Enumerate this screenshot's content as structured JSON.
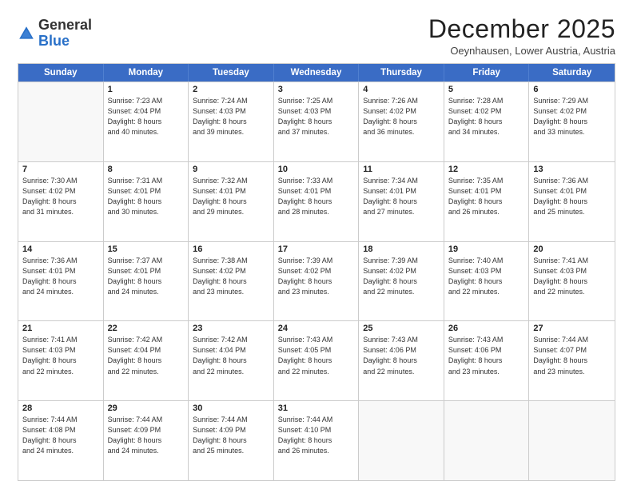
{
  "logo": {
    "general": "General",
    "blue": "Blue"
  },
  "title": "December 2025",
  "subtitle": "Oeynhausen, Lower Austria, Austria",
  "days": [
    "Sunday",
    "Monday",
    "Tuesday",
    "Wednesday",
    "Thursday",
    "Friday",
    "Saturday"
  ],
  "rows": [
    [
      {
        "day": "",
        "lines": []
      },
      {
        "day": "1",
        "lines": [
          "Sunrise: 7:23 AM",
          "Sunset: 4:04 PM",
          "Daylight: 8 hours",
          "and 40 minutes."
        ]
      },
      {
        "day": "2",
        "lines": [
          "Sunrise: 7:24 AM",
          "Sunset: 4:03 PM",
          "Daylight: 8 hours",
          "and 39 minutes."
        ]
      },
      {
        "day": "3",
        "lines": [
          "Sunrise: 7:25 AM",
          "Sunset: 4:03 PM",
          "Daylight: 8 hours",
          "and 37 minutes."
        ]
      },
      {
        "day": "4",
        "lines": [
          "Sunrise: 7:26 AM",
          "Sunset: 4:02 PM",
          "Daylight: 8 hours",
          "and 36 minutes."
        ]
      },
      {
        "day": "5",
        "lines": [
          "Sunrise: 7:28 AM",
          "Sunset: 4:02 PM",
          "Daylight: 8 hours",
          "and 34 minutes."
        ]
      },
      {
        "day": "6",
        "lines": [
          "Sunrise: 7:29 AM",
          "Sunset: 4:02 PM",
          "Daylight: 8 hours",
          "and 33 minutes."
        ]
      }
    ],
    [
      {
        "day": "7",
        "lines": [
          "Sunrise: 7:30 AM",
          "Sunset: 4:02 PM",
          "Daylight: 8 hours",
          "and 31 minutes."
        ]
      },
      {
        "day": "8",
        "lines": [
          "Sunrise: 7:31 AM",
          "Sunset: 4:01 PM",
          "Daylight: 8 hours",
          "and 30 minutes."
        ]
      },
      {
        "day": "9",
        "lines": [
          "Sunrise: 7:32 AM",
          "Sunset: 4:01 PM",
          "Daylight: 8 hours",
          "and 29 minutes."
        ]
      },
      {
        "day": "10",
        "lines": [
          "Sunrise: 7:33 AM",
          "Sunset: 4:01 PM",
          "Daylight: 8 hours",
          "and 28 minutes."
        ]
      },
      {
        "day": "11",
        "lines": [
          "Sunrise: 7:34 AM",
          "Sunset: 4:01 PM",
          "Daylight: 8 hours",
          "and 27 minutes."
        ]
      },
      {
        "day": "12",
        "lines": [
          "Sunrise: 7:35 AM",
          "Sunset: 4:01 PM",
          "Daylight: 8 hours",
          "and 26 minutes."
        ]
      },
      {
        "day": "13",
        "lines": [
          "Sunrise: 7:36 AM",
          "Sunset: 4:01 PM",
          "Daylight: 8 hours",
          "and 25 minutes."
        ]
      }
    ],
    [
      {
        "day": "14",
        "lines": [
          "Sunrise: 7:36 AM",
          "Sunset: 4:01 PM",
          "Daylight: 8 hours",
          "and 24 minutes."
        ]
      },
      {
        "day": "15",
        "lines": [
          "Sunrise: 7:37 AM",
          "Sunset: 4:01 PM",
          "Daylight: 8 hours",
          "and 24 minutes."
        ]
      },
      {
        "day": "16",
        "lines": [
          "Sunrise: 7:38 AM",
          "Sunset: 4:02 PM",
          "Daylight: 8 hours",
          "and 23 minutes."
        ]
      },
      {
        "day": "17",
        "lines": [
          "Sunrise: 7:39 AM",
          "Sunset: 4:02 PM",
          "Daylight: 8 hours",
          "and 23 minutes."
        ]
      },
      {
        "day": "18",
        "lines": [
          "Sunrise: 7:39 AM",
          "Sunset: 4:02 PM",
          "Daylight: 8 hours",
          "and 22 minutes."
        ]
      },
      {
        "day": "19",
        "lines": [
          "Sunrise: 7:40 AM",
          "Sunset: 4:03 PM",
          "Daylight: 8 hours",
          "and 22 minutes."
        ]
      },
      {
        "day": "20",
        "lines": [
          "Sunrise: 7:41 AM",
          "Sunset: 4:03 PM",
          "Daylight: 8 hours",
          "and 22 minutes."
        ]
      }
    ],
    [
      {
        "day": "21",
        "lines": [
          "Sunrise: 7:41 AM",
          "Sunset: 4:03 PM",
          "Daylight: 8 hours",
          "and 22 minutes."
        ]
      },
      {
        "day": "22",
        "lines": [
          "Sunrise: 7:42 AM",
          "Sunset: 4:04 PM",
          "Daylight: 8 hours",
          "and 22 minutes."
        ]
      },
      {
        "day": "23",
        "lines": [
          "Sunrise: 7:42 AM",
          "Sunset: 4:04 PM",
          "Daylight: 8 hours",
          "and 22 minutes."
        ]
      },
      {
        "day": "24",
        "lines": [
          "Sunrise: 7:43 AM",
          "Sunset: 4:05 PM",
          "Daylight: 8 hours",
          "and 22 minutes."
        ]
      },
      {
        "day": "25",
        "lines": [
          "Sunrise: 7:43 AM",
          "Sunset: 4:06 PM",
          "Daylight: 8 hours",
          "and 22 minutes."
        ]
      },
      {
        "day": "26",
        "lines": [
          "Sunrise: 7:43 AM",
          "Sunset: 4:06 PM",
          "Daylight: 8 hours",
          "and 23 minutes."
        ]
      },
      {
        "day": "27",
        "lines": [
          "Sunrise: 7:44 AM",
          "Sunset: 4:07 PM",
          "Daylight: 8 hours",
          "and 23 minutes."
        ]
      }
    ],
    [
      {
        "day": "28",
        "lines": [
          "Sunrise: 7:44 AM",
          "Sunset: 4:08 PM",
          "Daylight: 8 hours",
          "and 24 minutes."
        ]
      },
      {
        "day": "29",
        "lines": [
          "Sunrise: 7:44 AM",
          "Sunset: 4:09 PM",
          "Daylight: 8 hours",
          "and 24 minutes."
        ]
      },
      {
        "day": "30",
        "lines": [
          "Sunrise: 7:44 AM",
          "Sunset: 4:09 PM",
          "Daylight: 8 hours",
          "and 25 minutes."
        ]
      },
      {
        "day": "31",
        "lines": [
          "Sunrise: 7:44 AM",
          "Sunset: 4:10 PM",
          "Daylight: 8 hours",
          "and 26 minutes."
        ]
      },
      {
        "day": "",
        "lines": []
      },
      {
        "day": "",
        "lines": []
      },
      {
        "day": "",
        "lines": []
      }
    ]
  ]
}
